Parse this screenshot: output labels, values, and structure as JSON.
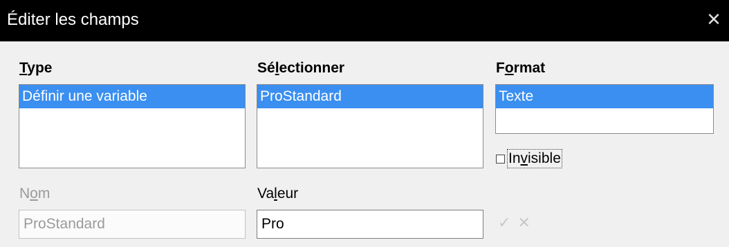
{
  "dialog": {
    "title": "Éditer les champs",
    "close_glyph": "✕"
  },
  "type": {
    "label_before": "",
    "label_mnemonic": "T",
    "label_after": "ype",
    "selected_item": "Définir une variable"
  },
  "select": {
    "label_before": "Sé",
    "label_mnemonic": "l",
    "label_after": "ectionner",
    "selected_item": "ProStandard"
  },
  "format": {
    "label_before": "F",
    "label_mnemonic": "o",
    "label_after": "rmat",
    "selected_item": "Texte"
  },
  "invisible": {
    "label_before": "In",
    "label_mnemonic": "v",
    "label_after": "isible",
    "checked": false
  },
  "name": {
    "label_before": "N",
    "label_mnemonic": "o",
    "label_after": "m",
    "value": "ProStandard"
  },
  "value": {
    "label_before": "Va",
    "label_mnemonic": "l",
    "label_after": "eur",
    "value": "Pro"
  },
  "icons": {
    "apply": "check-icon",
    "remove": "x-icon",
    "apply_glyph": "✓",
    "remove_glyph": "✕"
  },
  "colors": {
    "selection": "#3a8ff0",
    "titlebar": "#000000",
    "disabled_text": "#9a9a9a"
  }
}
